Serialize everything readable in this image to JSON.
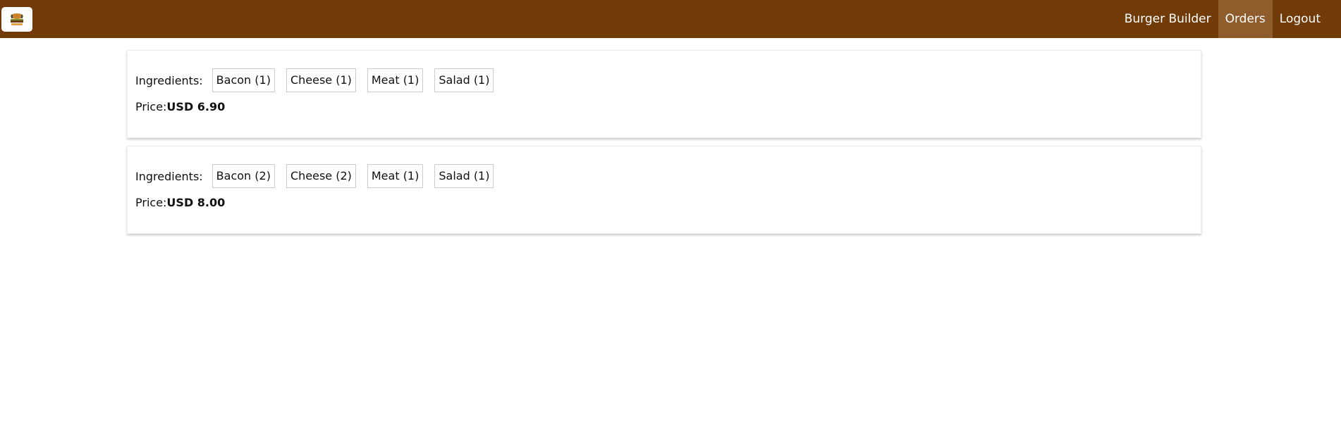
{
  "toolbar": {
    "logo_icon": "burger-logo-icon",
    "nav": [
      {
        "label": "Burger Builder",
        "active": false
      },
      {
        "label": "Orders",
        "active": true
      },
      {
        "label": "Logout",
        "active": false
      }
    ]
  },
  "orders": [
    {
      "ingredients_label": "Ingredients:",
      "ingredients": [
        "Bacon (1)",
        "Cheese (1)",
        "Meat (1)",
        "Salad (1)"
      ],
      "price_label": "Price:",
      "price": "USD 6.90"
    },
    {
      "ingredients_label": "Ingredients:",
      "ingredients": [
        "Bacon (2)",
        "Cheese (2)",
        "Meat (1)",
        "Salad (1)"
      ],
      "price_label": "Price:",
      "price": "USD 8.00"
    }
  ],
  "colors": {
    "toolbar_bg": "#703b09",
    "active_nav_bg": "#8f5c2c"
  }
}
